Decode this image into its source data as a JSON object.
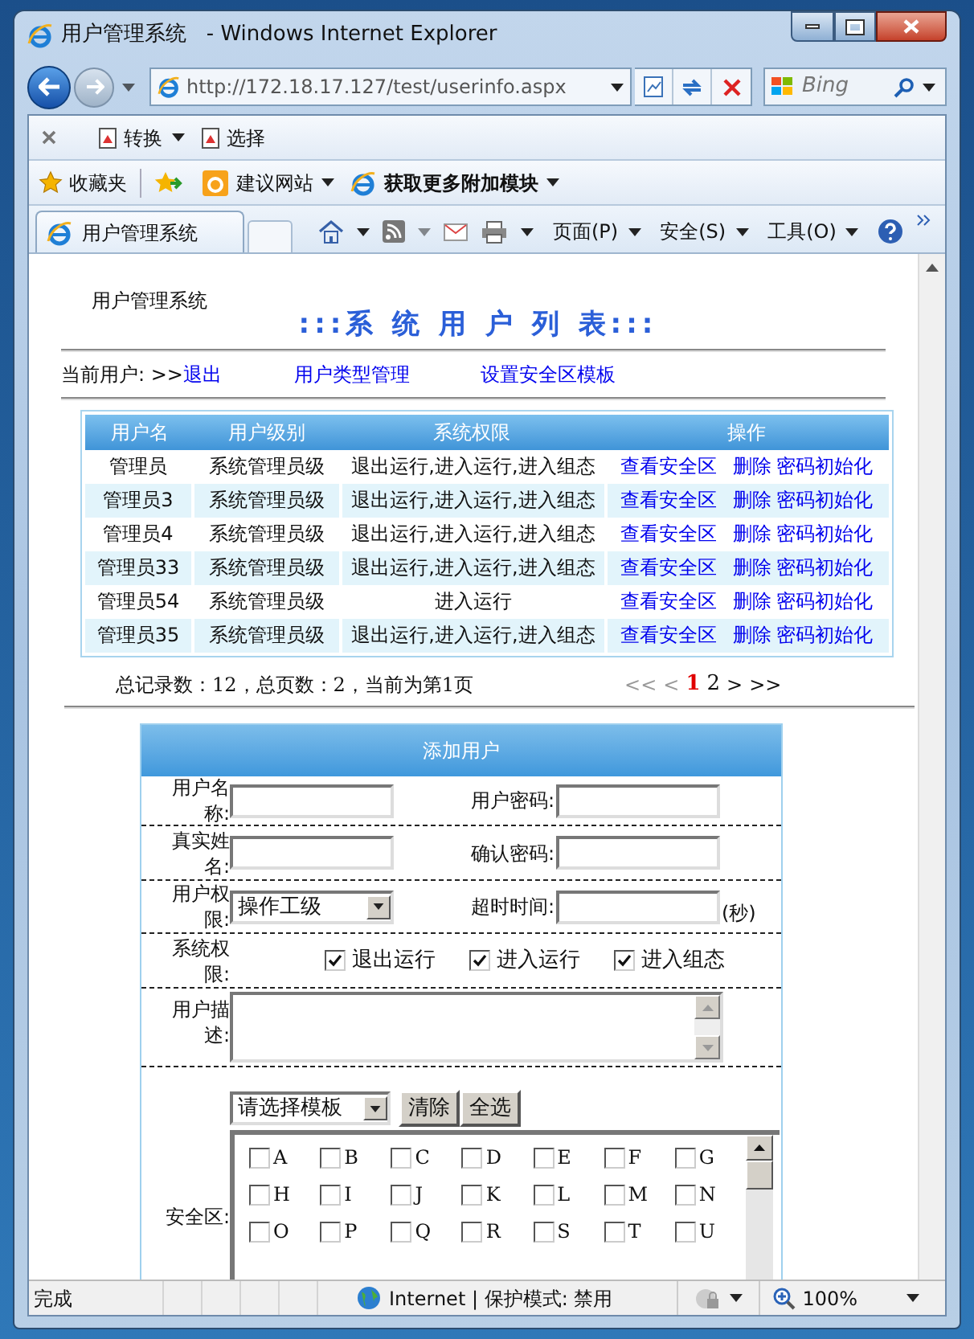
{
  "window": {
    "title": "用户管理系统   - Windows Internet Explorer"
  },
  "address_bar": {
    "url": "http://172.18.17.127/test/userinfo.aspx"
  },
  "search": {
    "placeholder": "Bing"
  },
  "toolbar": [
    {
      "label": "转换",
      "dropdown": true
    },
    {
      "label": "选择",
      "dropdown": false
    }
  ],
  "favorites_bar": {
    "label": "收藏夹",
    "items": [
      {
        "label": "建议网站",
        "bold": false
      },
      {
        "label": "获取更多附加模块",
        "bold": true
      }
    ]
  },
  "tab": {
    "label": "用户管理系统"
  },
  "command_bar": [
    "页面(P)",
    "安全(S)",
    "工具(O)"
  ],
  "page": {
    "app_name": "用户管理系统",
    "heading": ":::系 统 用 户 列 表:::",
    "nav": {
      "current_user": "当前用户: >>",
      "logout": "退出",
      "links": [
        "用户类型管理",
        "设置安全区模板"
      ]
    },
    "users_table": {
      "columns": [
        "用户名",
        "用户级别",
        "系统权限",
        "操作"
      ],
      "rows": [
        {
          "name": "管理员",
          "level": "系统管理员级",
          "permissions": "退出运行,进入运行,进入组态",
          "actions": [
            "查看安全区",
            "删除",
            "密码初始化"
          ]
        },
        {
          "name": "管理员3",
          "level": "系统管理员级",
          "permissions": "退出运行,进入运行,进入组态",
          "actions": [
            "查看安全区",
            "删除",
            "密码初始化"
          ]
        },
        {
          "name": "管理员4",
          "level": "系统管理员级",
          "permissions": "退出运行,进入运行,进入组态",
          "actions": [
            "查看安全区",
            "删除",
            "密码初始化"
          ]
        },
        {
          "name": "管理员33",
          "level": "系统管理员级",
          "permissions": "退出运行,进入运行,进入组态",
          "actions": [
            "查看安全区",
            "删除",
            "密码初始化"
          ]
        },
        {
          "name": "管理员54",
          "level": "系统管理员级",
          "permissions": "进入运行",
          "actions": [
            "查看安全区",
            "删除",
            "密码初始化"
          ]
        },
        {
          "name": "管理员35",
          "level": "系统管理员级",
          "permissions": "退出运行,进入运行,进入组态",
          "actions": [
            "查看安全区",
            "删除",
            "密码初始化"
          ]
        }
      ]
    },
    "summary": "总记录数：12，总页数：2，当前为第1页",
    "pager": [
      {
        "label": "<<",
        "kind": "nav",
        "disabled": true
      },
      {
        "label": "<",
        "kind": "nav",
        "disabled": true
      },
      {
        "label": "1",
        "kind": "page",
        "selected": true
      },
      {
        "label": "2",
        "kind": "page",
        "selected": false
      },
      {
        "label": ">",
        "kind": "nav",
        "disabled": false
      },
      {
        "label": ">>",
        "kind": "nav",
        "disabled": false
      }
    ],
    "form": {
      "title": "添加用户",
      "username": {
        "label": "用户名称:"
      },
      "password": {
        "label": "用户密码:"
      },
      "real_name": {
        "label": "真实姓名:"
      },
      "confirm_password": {
        "label": "确认密码:"
      },
      "permission": {
        "label": "用户权限:",
        "value": "操作工级"
      },
      "timeout": {
        "label": "超时时间:",
        "unit": "(秒)"
      },
      "system_rights": {
        "label": "系统权限:",
        "options": [
          {
            "label": "退出运行",
            "checked": true
          },
          {
            "label": "进入运行",
            "checked": true
          },
          {
            "label": "进入组态",
            "checked": true
          }
        ]
      },
      "description": {
        "label": "用户描述:"
      },
      "security_zone": {
        "label": "安全区:",
        "template": "请选择模板",
        "buttons": [
          "清除",
          "全选"
        ],
        "zones": [
          {
            "label": "A",
            "checked": false
          },
          {
            "label": "B",
            "checked": false
          },
          {
            "label": "C",
            "checked": false
          },
          {
            "label": "D",
            "checked": false
          },
          {
            "label": "E",
            "checked": false
          },
          {
            "label": "F",
            "checked": false
          },
          {
            "label": "G",
            "checked": false
          },
          {
            "label": "H",
            "checked": false
          },
          {
            "label": "I",
            "checked": false
          },
          {
            "label": "J",
            "checked": false
          },
          {
            "label": "K",
            "checked": false
          },
          {
            "label": "L",
            "checked": false
          },
          {
            "label": "M",
            "checked": false
          },
          {
            "label": "N",
            "checked": false
          },
          {
            "label": "O",
            "checked": false
          },
          {
            "label": "P",
            "checked": false
          },
          {
            "label": "Q",
            "checked": false
          },
          {
            "label": "R",
            "checked": false
          },
          {
            "label": "S",
            "checked": false
          },
          {
            "label": "T",
            "checked": false
          },
          {
            "label": "U",
            "checked": false
          }
        ]
      }
    }
  },
  "status_bar": {
    "text": "完成",
    "zone": "Internet | 保护模式: 禁用",
    "zoom": "100%"
  }
}
